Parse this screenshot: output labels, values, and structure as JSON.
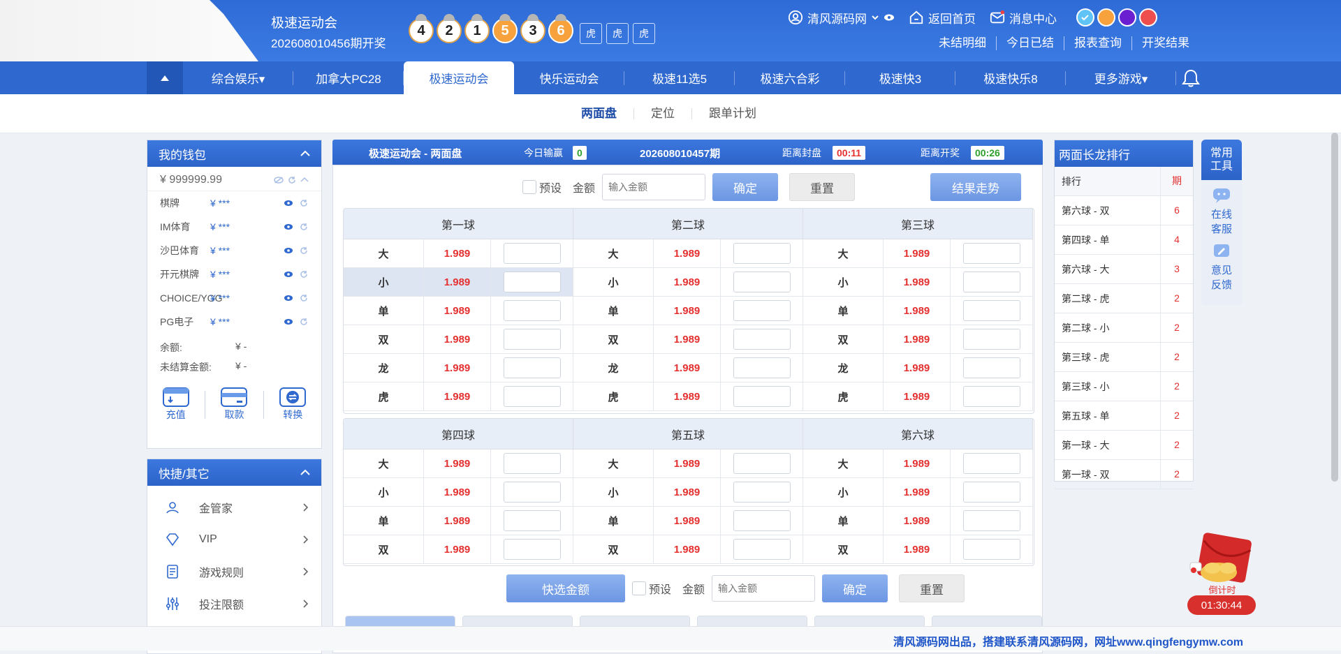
{
  "header": {
    "game_name": "极速运动会",
    "open_issue": "202608010456期开奖",
    "balls": [
      "4",
      "2",
      "1",
      "5",
      "3",
      "6"
    ],
    "tags": [
      "虎",
      "虎",
      "虎"
    ],
    "user_name": "清风源码网",
    "home_label": "返回首页",
    "message_label": "消息中心",
    "theme_colors": [
      "#5fc3f5",
      "#f7a23d",
      "#6a1fd0",
      "#ee4e4e"
    ],
    "sub_links": [
      "未结明细",
      "今日已结",
      "报表查询",
      "开奖结果"
    ]
  },
  "nav": {
    "items": [
      "综合娱乐▾",
      "加拿大PC28",
      "极速运动会",
      "快乐运动会",
      "极速11选5",
      "极速六合彩",
      "极速快3",
      "极速快乐8",
      "更多游戏▾"
    ],
    "active_index": 2
  },
  "subnav": [
    "两面盘",
    "定位",
    "跟单计划"
  ],
  "wallet": {
    "title": "我的钱包",
    "balance": "¥ 999999.99",
    "items": [
      {
        "name": "棋牌",
        "amount": "¥ ***"
      },
      {
        "name": "IM体育",
        "amount": "¥ ***"
      },
      {
        "name": "沙巴体育",
        "amount": "¥ ***"
      },
      {
        "name": "开元棋牌",
        "amount": "¥ ***"
      },
      {
        "name": "CHOICE/YGG",
        "amount": "¥ ***"
      },
      {
        "name": "PG电子",
        "amount": "¥ ***"
      }
    ],
    "summary": [
      {
        "k": "余额:",
        "v": "¥ -"
      },
      {
        "k": "未结算金额:",
        "v": "¥ -"
      }
    ],
    "actions": [
      "充值",
      "取款",
      "转换"
    ]
  },
  "quick": {
    "title": "快捷/其它",
    "items": [
      "金管家",
      "VIP",
      "游戏规则",
      "投注限额"
    ]
  },
  "bet": {
    "title": "极速运动会 - 两面盘",
    "today_label": "今日输赢",
    "today_value": "0",
    "issue": "202608010457期",
    "close_label": "距离封盘",
    "close_value": "00:11",
    "draw_label": "距离开奖",
    "draw_value": "00:26",
    "preset_label": "预设",
    "amount_label": "金额",
    "amount_placeholder": "输入金额",
    "confirm_label": "确定",
    "reset_label": "重置",
    "trend_label": "结果走势",
    "quick_amount_label": "快选金额",
    "top_balls": [
      "第一球",
      "第二球",
      "第三球"
    ],
    "bottom_balls": [
      "第四球",
      "第五球",
      "第六球"
    ],
    "top_rows": [
      {
        "name": "大",
        "odds": "1.989"
      },
      {
        "name": "小",
        "odds": "1.989"
      },
      {
        "name": "单",
        "odds": "1.989"
      },
      {
        "name": "双",
        "odds": "1.989"
      },
      {
        "name": "龙",
        "odds": "1.989"
      },
      {
        "name": "虎",
        "odds": "1.989"
      }
    ],
    "bottom_rows": [
      {
        "name": "大",
        "odds": "1.989"
      },
      {
        "name": "小",
        "odds": "1.989"
      },
      {
        "name": "单",
        "odds": "1.989"
      },
      {
        "name": "双",
        "odds": "1.989"
      }
    ]
  },
  "rank": {
    "title": "两面长龙排行",
    "col_name": "排行",
    "col_value": "期",
    "rows": [
      {
        "name": "第六球 - 双",
        "value": "6"
      },
      {
        "name": "第四球 - 单",
        "value": "4"
      },
      {
        "name": "第六球 - 大",
        "value": "3"
      },
      {
        "name": "第二球 - 虎",
        "value": "2"
      },
      {
        "name": "第二球 - 小",
        "value": "2"
      },
      {
        "name": "第三球 - 虎",
        "value": "2"
      },
      {
        "name": "第三球 - 小",
        "value": "2"
      },
      {
        "name": "第五球 - 单",
        "value": "2"
      },
      {
        "name": "第一球 - 大",
        "value": "2"
      },
      {
        "name": "第一球 - 双",
        "value": "2"
      }
    ]
  },
  "tools": {
    "title": "常用工具",
    "items": [
      "在线客服",
      "意见反馈"
    ]
  },
  "countdown": {
    "label": "倒计时",
    "value": "01:30:44"
  },
  "footer": "清风源码网出品，搭建联系清风源码网，网址www.qingfengymw.com"
}
